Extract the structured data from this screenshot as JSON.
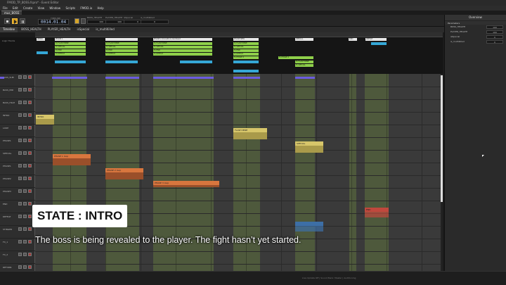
{
  "window": {
    "title": "FMOD_TP_BOSS.fspro* - Event Editor"
  },
  "menu": [
    "File",
    "Edit",
    "Create",
    "View",
    "Window",
    "Scripts",
    "FMOD.io",
    "Help"
  ],
  "document_tab": "mus_BOSS",
  "transport": {
    "timecode_label": "TIMELINE",
    "timecode": "0014.01.04",
    "params": [
      {
        "label": "BOSS_HEALTH",
        "value": "100"
      },
      {
        "label": "PLAYER_HEALTH",
        "value": "100"
      },
      {
        "label": "isSpecial",
        "value": "0"
      },
      {
        "label": "is_multiKilled",
        "value": "0"
      }
    ]
  },
  "param_tabs": [
    "Timeline",
    "BOSS_HEALTH",
    "PLAYER_HEALTH",
    "isSpecial",
    "is_multiKilled"
  ],
  "logic": {
    "label": "Logic Tracks",
    "markers": [
      {
        "label": "INTRO"
      },
      {
        "label": "PHASE 1"
      },
      {
        "label": "PHASE 2 (transition) backbeat"
      },
      {
        "label": "PHASE NEW"
      },
      {
        "label": "SPECIAL"
      },
      {
        "label": "END"
      },
      {
        "label": "DEFEAT"
      }
    ],
    "transitions": [
      "To FLASH MINE",
      "To SPECIAL",
      "To END",
      "To DEFEAT",
      "To PHASE 2"
    ]
  },
  "tracks": [
    "BASS_SUB",
    "BASS_MID",
    "BASS_HIGH",
    "INTRO",
    "LOOP",
    "PHASE1",
    "SPECIAL",
    "PHASE1",
    "PHASE2",
    "PHASE3",
    "END",
    "DEFEAT",
    "STINGER",
    "FX_1",
    "FX_2",
    "RETURN"
  ],
  "regions": [
    {
      "label": "INTRO"
    },
    {
      "label": "PHASE 1 loop"
    },
    {
      "label": "PHASE 2 loop"
    },
    {
      "label": "PHASE 3 loop"
    },
    {
      "label": "FLASH MINE"
    },
    {
      "label": "SPECIAL"
    },
    {
      "label": "END"
    }
  ],
  "overview": {
    "title": "Overview",
    "section": "Parameters",
    "rows": [
      {
        "name": "BOSS_HEALTH",
        "value": "100"
      },
      {
        "name": "PLAYER_HEALTH",
        "value": "100"
      },
      {
        "name": "isSpecial",
        "value": "0"
      },
      {
        "name": "is_multiKilled",
        "value": "0"
      }
    ]
  },
  "status": "Live Update Off  |  Sound Bank: Master  |  Auditioning",
  "overlay": {
    "title": "STATE : INTRO",
    "caption": "The boss is being revealed to the player. The fight hasn’t yet started."
  }
}
